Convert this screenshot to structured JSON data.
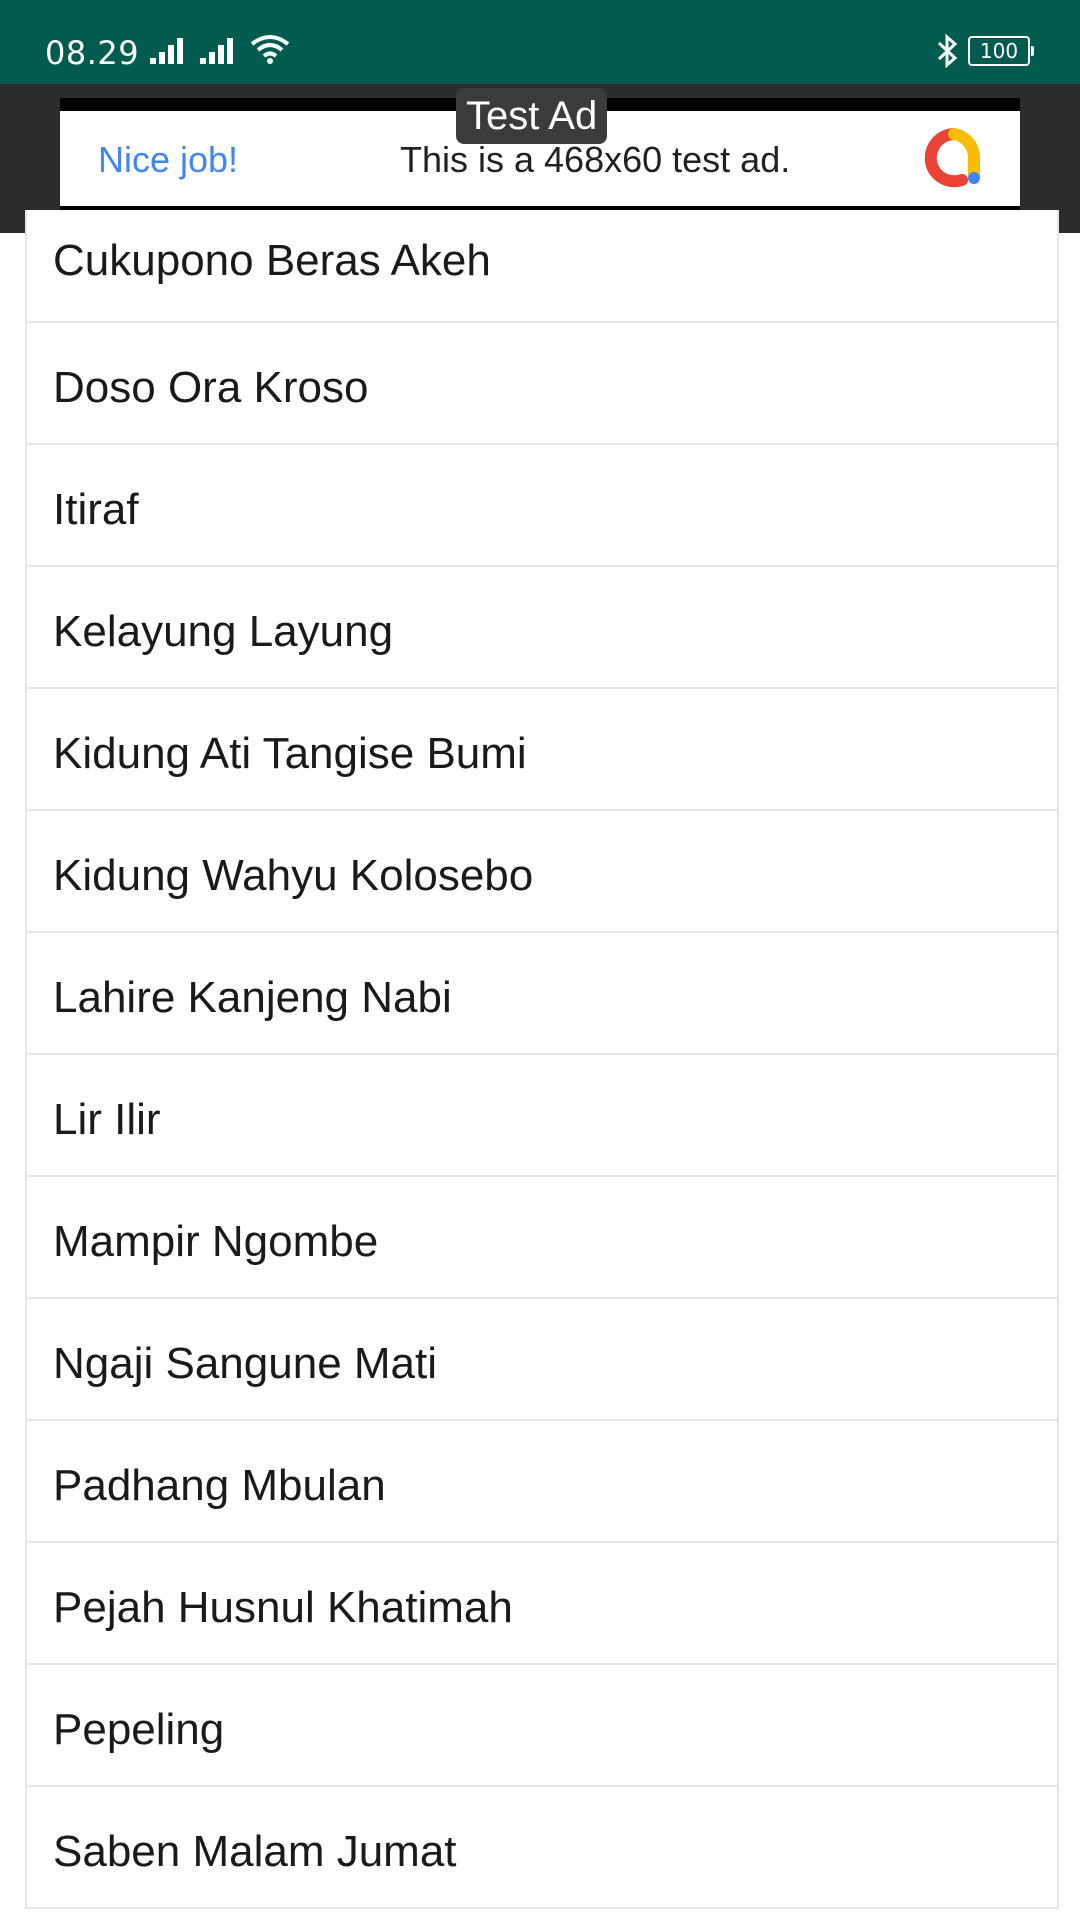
{
  "status_bar": {
    "time": "08.29",
    "battery": "100",
    "background": "#015c4f"
  },
  "ad": {
    "badge": "Test Ad",
    "nice": "Nice job!",
    "text": "This is a 468x60 test ad.",
    "logo_icon": "google-ads-icon"
  },
  "list": {
    "items": [
      {
        "label": "Cukupono Beras Akeh"
      },
      {
        "label": "Doso Ora Kroso"
      },
      {
        "label": "Itiraf"
      },
      {
        "label": "Kelayung Layung"
      },
      {
        "label": "Kidung Ati Tangise Bumi"
      },
      {
        "label": "Kidung Wahyu Kolosebo"
      },
      {
        "label": "Lahire Kanjeng Nabi"
      },
      {
        "label": "Lir Ilir"
      },
      {
        "label": "Mampir Ngombe"
      },
      {
        "label": "Ngaji Sangune Mati"
      },
      {
        "label": "Padhang Mbulan"
      },
      {
        "label": "Pejah Husnul Khatimah"
      },
      {
        "label": "Pepeling"
      },
      {
        "label": "Saben Malam Jumat"
      }
    ]
  }
}
